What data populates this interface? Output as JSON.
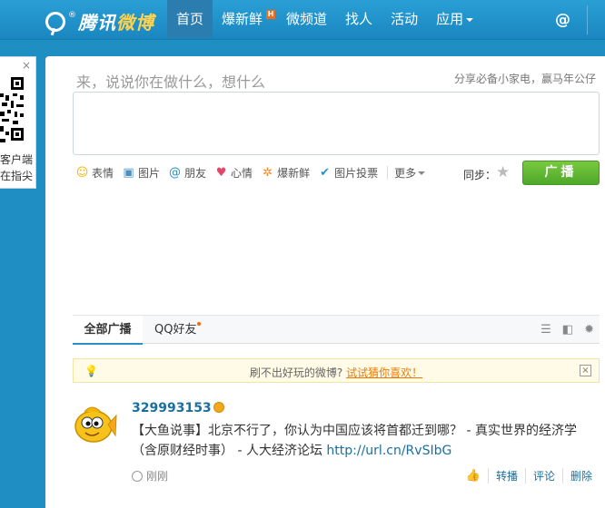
{
  "header": {
    "logo": {
      "brand": "腾讯",
      "product": "微博",
      "reg": "®"
    },
    "nav": [
      {
        "label": "首页",
        "active": true
      },
      {
        "label": "爆新鲜",
        "badge": "H"
      },
      {
        "label": "微频道"
      },
      {
        "label": "找人"
      },
      {
        "label": "活动"
      },
      {
        "label": "应用",
        "has_dropdown": true
      }
    ],
    "at_icon": "@"
  },
  "qr_card": {
    "close": "×",
    "line1": "客户端",
    "line2": "在指尖"
  },
  "composer": {
    "prompt": "来，说说你在做什么，想什么",
    "hint": "分享必备小家电，赢马年公仔",
    "tools": [
      {
        "icon": "smile-icon",
        "label": "表情"
      },
      {
        "icon": "image-icon",
        "label": "图片"
      },
      {
        "icon": "at-friend-icon",
        "label": "朋友"
      },
      {
        "icon": "heart-icon",
        "label": "心情"
      },
      {
        "icon": "sparkle-icon",
        "label": "爆新鲜"
      },
      {
        "icon": "vote-icon",
        "label": "图片投票"
      }
    ],
    "more_label": "更多",
    "sync_label": "同步：",
    "submit_label": "广播"
  },
  "feed_tabs": {
    "all": "全部广播",
    "qq": "QQ好友"
  },
  "notice": {
    "text": "刷不出好玩的微博?",
    "link": "试试猜你喜欢！",
    "close": "×"
  },
  "post": {
    "username": "329993153",
    "text": "【大鱼说事】北京不行了，你认为中国应该将首都迁到哪？ - 真实世界的经济学（含原财经时事） - 人大经济论坛 ",
    "link": "http://url.cn/RvSIbG",
    "time": "刚刚",
    "actions": {
      "forward": "转播",
      "comment": "评论",
      "delete": "删除"
    }
  },
  "colors": {
    "topbar": "#1f8ec3",
    "submit_green": "#5fb12f",
    "link_blue": "#1a6f9c",
    "notice_orange": "#f07a00"
  }
}
